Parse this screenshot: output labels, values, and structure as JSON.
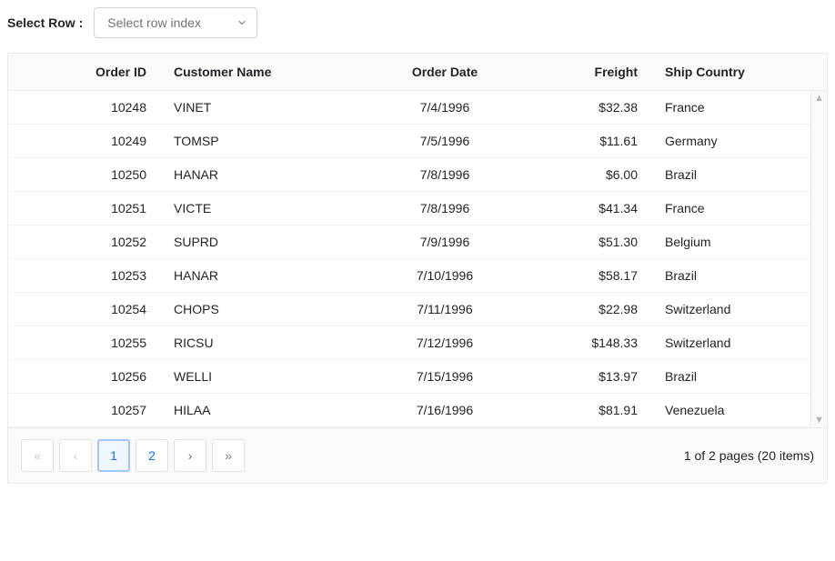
{
  "top": {
    "label": "Select Row :",
    "dropdown_placeholder": "Select row index"
  },
  "columns": {
    "order": "Order ID",
    "customer": "Customer Name",
    "date": "Order Date",
    "freight": "Freight",
    "country": "Ship Country"
  },
  "rows": [
    {
      "order": "10248",
      "customer": "VINET",
      "date": "7/4/1996",
      "freight": "$32.38",
      "country": "France"
    },
    {
      "order": "10249",
      "customer": "TOMSP",
      "date": "7/5/1996",
      "freight": "$11.61",
      "country": "Germany"
    },
    {
      "order": "10250",
      "customer": "HANAR",
      "date": "7/8/1996",
      "freight": "$6.00",
      "country": "Brazil"
    },
    {
      "order": "10251",
      "customer": "VICTE",
      "date": "7/8/1996",
      "freight": "$41.34",
      "country": "France"
    },
    {
      "order": "10252",
      "customer": "SUPRD",
      "date": "7/9/1996",
      "freight": "$51.30",
      "country": "Belgium"
    },
    {
      "order": "10253",
      "customer": "HANAR",
      "date": "7/10/1996",
      "freight": "$58.17",
      "country": "Brazil"
    },
    {
      "order": "10254",
      "customer": "CHOPS",
      "date": "7/11/1996",
      "freight": "$22.98",
      "country": "Switzerland"
    },
    {
      "order": "10255",
      "customer": "RICSU",
      "date": "7/12/1996",
      "freight": "$148.33",
      "country": "Switzerland"
    },
    {
      "order": "10256",
      "customer": "WELLI",
      "date": "7/15/1996",
      "freight": "$13.97",
      "country": "Brazil"
    },
    {
      "order": "10257",
      "customer": "HILAA",
      "date": "7/16/1996",
      "freight": "$81.91",
      "country": "Venezuela"
    }
  ],
  "pager": {
    "first": "«",
    "prev": "‹",
    "page1": "1",
    "page2": "2",
    "next": "›",
    "last": "»",
    "info": "1 of 2 pages (20 items)"
  }
}
